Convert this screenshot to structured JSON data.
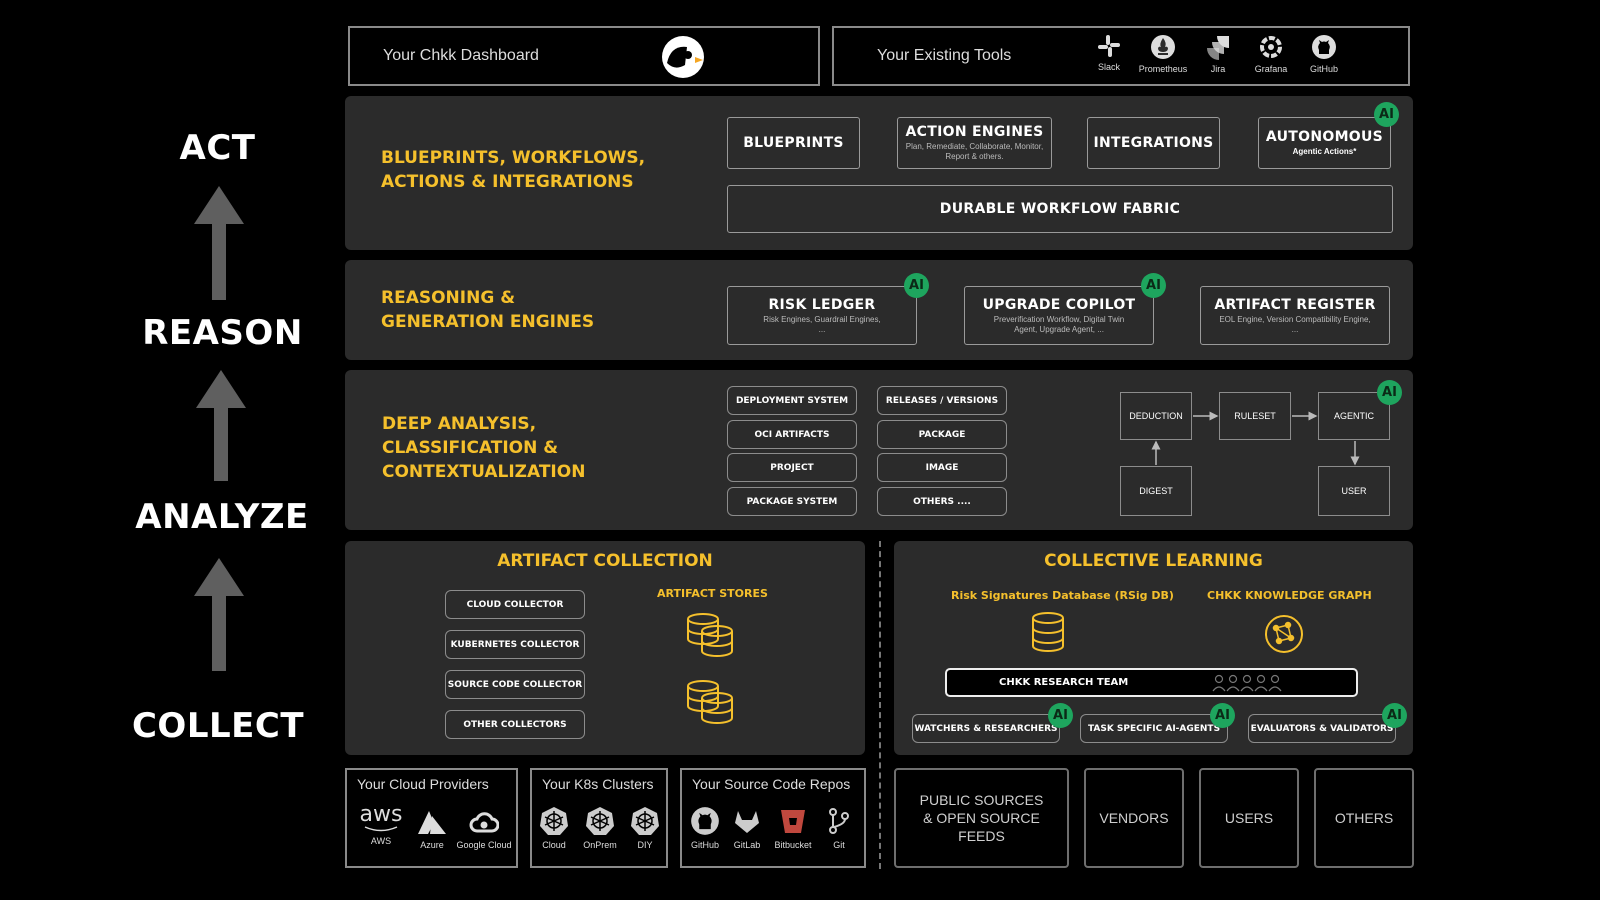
{
  "stages": {
    "act": "ACT",
    "reason": "REASON",
    "analyze": "ANALYZE",
    "collect": "COLLECT"
  },
  "dashboard": {
    "label": "Your Chkk Dashboard"
  },
  "existing_tools": {
    "label": "Your Existing Tools",
    "tools": [
      "Slack",
      "Prometheus",
      "Jira",
      "Grafana",
      "GitHub"
    ]
  },
  "act_panel": {
    "title_line1": "BLUEPRINTS, WORKFLOWS,",
    "title_line2": "ACTIONS & INTEGRATIONS",
    "blueprints": "BLUEPRINTS",
    "action_engines": {
      "title": "ACTION ENGINES",
      "subtitle": "Plan, Remediate, Collaborate, Monitor, Report & others."
    },
    "integrations": "INTEGRATIONS",
    "autonomous": {
      "title": "AUTONOMOUS",
      "subtitle": "Agentic Actions*"
    },
    "fabric": "DURABLE WORKFLOW FABRIC"
  },
  "ai_badge": "AI",
  "reason_panel": {
    "title_line1": "REASONING &",
    "title_line2": "GENERATION ENGINES",
    "risk_ledger": {
      "title": "RISK LEDGER",
      "subtitle1": "Risk Engines, Guardrail Engines,",
      "subtitle2": "..."
    },
    "upgrade_copilot": {
      "title": "UPGRADE COPILOT",
      "subtitle1": "Preverification Workflow, Digital Twin",
      "subtitle2": "Agent, Upgrade Agent, ..."
    },
    "artifact_register": {
      "title": "ARTIFACT REGISTER",
      "subtitle1": "EOL Engine, Version Compatibility Engine,",
      "subtitle2": "..."
    }
  },
  "analyze_panel": {
    "title_line1": "DEEP ANALYSIS,",
    "title_line2": "CLASSIFICATION &",
    "title_line3": "CONTEXTUALIZATION",
    "left_items": [
      "DEPLOYMENT SYSTEM",
      "OCI ARTIFACTS",
      "PROJECT",
      "PACKAGE SYSTEM"
    ],
    "right_items": [
      "RELEASES / VERSIONS",
      "PACKAGE",
      "IMAGE",
      "OTHERS ...."
    ],
    "flow": {
      "deduction": "DEDUCTION",
      "ruleset": "RULESET",
      "agentic": "AGENTIC",
      "digest": "DIGEST",
      "user": "USER"
    }
  },
  "artifact_collection": {
    "title": "ARTIFACT COLLECTION",
    "collectors": [
      "CLOUD COLLECTOR",
      "KUBERNETES COLLECTOR",
      "SOURCE CODE COLLECTOR",
      "OTHER COLLECTORS"
    ],
    "stores_title": "ARTIFACT STORES"
  },
  "collective_learning": {
    "title": "COLLECTIVE LEARNING",
    "rsig": "Risk Signatures Database (RSig DB)",
    "knowledge_graph": "CHKK KNOWLEDGE GRAPH",
    "research_team": "CHKK RESEARCH TEAM",
    "agents": [
      "WATCHERS & RESEARCHERS",
      "TASK SPECIFIC AI-AGENTS",
      "EVALUATORS & VALIDATORS"
    ]
  },
  "cloud_providers": {
    "title": "Your Cloud Providers",
    "items": [
      "AWS",
      "Azure",
      "Google Cloud"
    ],
    "aws_logo_text": "aws"
  },
  "k8s_clusters": {
    "title": "Your K8s Clusters",
    "items": [
      "Cloud",
      "OnPrem",
      "DIY"
    ]
  },
  "source_repos": {
    "title": "Your Source Code Repos",
    "items": [
      "GitHub",
      "GitLab",
      "Bitbucket",
      "Git"
    ]
  },
  "external_sources": {
    "public_line1": "PUBLIC SOURCES",
    "public_line2": "& OPEN SOURCE",
    "public_line3": "FEEDS",
    "vendors": "VENDORS",
    "users": "USERS",
    "others": "OTHERS"
  },
  "colors": {
    "accent_yellow": "#f5c02c",
    "ai_green": "#1ea55e",
    "panel": "#2b2b2b"
  }
}
